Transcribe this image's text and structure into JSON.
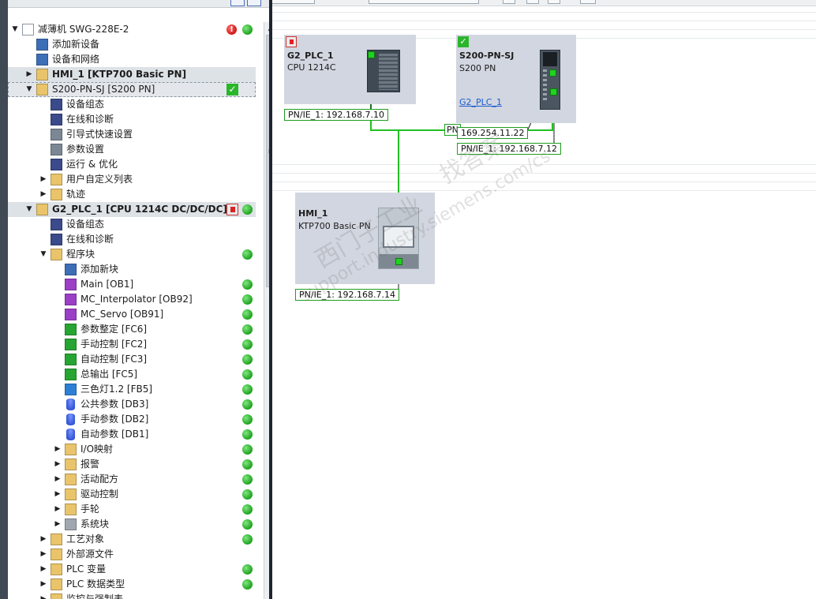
{
  "tree": {
    "rows": [
      {
        "label": "减薄机  SWG-228E-2",
        "indent": 0,
        "expander": "▼",
        "icon": "project-icon",
        "status": "error-ok"
      },
      {
        "label": "添加新设备",
        "indent": 1,
        "expander": "",
        "icon": "add-device-icon"
      },
      {
        "label": "设备和网络",
        "indent": 1,
        "expander": "",
        "icon": "devices-networks-icon"
      },
      {
        "label": "HMI_1 [KTP700 Basic PN]",
        "indent": 1,
        "expander": "▶",
        "icon": "hmi-folder-icon",
        "style": "header"
      },
      {
        "label": "S200-PN-SJ [S200 PN]",
        "indent": 1,
        "expander": "▼",
        "icon": "drive-icon",
        "style": "selected",
        "status": "check"
      },
      {
        "label": "设备组态",
        "indent": 2,
        "expander": "",
        "icon": "device-config-icon"
      },
      {
        "label": "在线和诊断",
        "indent": 2,
        "expander": "",
        "icon": "online-diagnostics-icon"
      },
      {
        "label": "引导式快速设置",
        "indent": 2,
        "expander": "",
        "icon": "quick-setup-icon"
      },
      {
        "label": "参数设置",
        "indent": 2,
        "expander": "",
        "icon": "parameter-icon"
      },
      {
        "label": "运行 & 优化",
        "indent": 2,
        "expander": "",
        "icon": "commissioning-icon"
      },
      {
        "label": "用户自定义列表",
        "indent": 2,
        "expander": "▶",
        "icon": "custom-list-icon"
      },
      {
        "label": "轨迹",
        "indent": 2,
        "expander": "▶",
        "icon": "trace-icon"
      },
      {
        "label": "G2_PLC_1 [CPU 1214C DC/DC/DC]",
        "indent": 1,
        "expander": "▼",
        "icon": "plc-icon",
        "style": "header",
        "status": "download-ok"
      },
      {
        "label": "设备组态",
        "indent": 2,
        "expander": "",
        "icon": "device-config-icon"
      },
      {
        "label": "在线和诊断",
        "indent": 2,
        "expander": "",
        "icon": "online-diagnostics-icon"
      },
      {
        "label": "程序块",
        "indent": 2,
        "expander": "▼",
        "icon": "program-blocks-icon",
        "status": "ok"
      },
      {
        "label": "添加新块",
        "indent": 3,
        "expander": "",
        "icon": "add-block-icon"
      },
      {
        "label": "Main [OB1]",
        "indent": 3,
        "expander": "",
        "icon": "ob-block-icon",
        "status": "ok"
      },
      {
        "label": "MC_Interpolator [OB92]",
        "indent": 3,
        "expander": "",
        "icon": "ob-block-icon",
        "status": "ok"
      },
      {
        "label": "MC_Servo [OB91]",
        "indent": 3,
        "expander": "",
        "icon": "ob-block-icon",
        "status": "ok"
      },
      {
        "label": "参数整定 [FC6]",
        "indent": 3,
        "expander": "",
        "icon": "fc-block-icon",
        "status": "ok"
      },
      {
        "label": "手动控制 [FC2]",
        "indent": 3,
        "expander": "",
        "icon": "fc-block-icon",
        "status": "ok"
      },
      {
        "label": "自动控制 [FC3]",
        "indent": 3,
        "expander": "",
        "icon": "fc-block-icon",
        "status": "ok"
      },
      {
        "label": "总输出 [FC5]",
        "indent": 3,
        "expander": "",
        "icon": "fc-block-icon",
        "status": "ok"
      },
      {
        "label": "三色灯1.2 [FB5]",
        "indent": 3,
        "expander": "",
        "icon": "fb-block-icon",
        "status": "ok"
      },
      {
        "label": "公共参数 [DB3]",
        "indent": 3,
        "expander": "",
        "icon": "db-block-icon",
        "status": "ok"
      },
      {
        "label": "手动参数 [DB2]",
        "indent": 3,
        "expander": "",
        "icon": "db-block-icon",
        "status": "ok"
      },
      {
        "label": "自动参数 [DB1]",
        "indent": 3,
        "expander": "",
        "icon": "db-block-icon",
        "status": "ok"
      },
      {
        "label": "I/O映射",
        "indent": 3,
        "expander": "▶",
        "icon": "group-folder-icon",
        "status": "ok"
      },
      {
        "label": "报警",
        "indent": 3,
        "expander": "▶",
        "icon": "group-folder-icon",
        "status": "ok"
      },
      {
        "label": "活动配方",
        "indent": 3,
        "expander": "▶",
        "icon": "group-folder-icon",
        "status": "ok"
      },
      {
        "label": "驱动控制",
        "indent": 3,
        "expander": "▶",
        "icon": "group-folder-icon",
        "status": "ok"
      },
      {
        "label": "手轮",
        "indent": 3,
        "expander": "▶",
        "icon": "group-folder-icon",
        "status": "ok"
      },
      {
        "label": "系统块",
        "indent": 3,
        "expander": "▶",
        "icon": "system-blocks-icon",
        "status": "ok"
      },
      {
        "label": "工艺对象",
        "indent": 2,
        "expander": "▶",
        "icon": "technology-objects-icon",
        "status": "ok"
      },
      {
        "label": "外部源文件",
        "indent": 2,
        "expander": "▶",
        "icon": "external-source-icon"
      },
      {
        "label": "PLC 变量",
        "indent": 2,
        "expander": "▶",
        "icon": "plc-tags-icon",
        "status": "ok"
      },
      {
        "label": "PLC 数据类型",
        "indent": 2,
        "expander": "▶",
        "icon": "plc-datatypes-icon",
        "status": "ok"
      },
      {
        "label": "监控与强制表",
        "indent": 2,
        "expander": "▶",
        "icon": "watch-force-icon"
      }
    ]
  },
  "network": {
    "devices": {
      "plc": {
        "name": "G2_PLC_1",
        "type": "CPU 1214C",
        "badge": "download-icon"
      },
      "drive": {
        "name": "S200-PN-SJ",
        "type": "S200 PN",
        "link": "G2_PLC_1",
        "badge": "check-icon"
      },
      "hmi": {
        "name": "HMI_1",
        "type": "KTP700 Basic PN"
      }
    },
    "labels": {
      "plc_ip": "PN/IE_1:  192.168.7.10",
      "drive_ip": "PN/IE_1:  192.168.7.12",
      "hmi_ip": "PN/IE_1:  192.168.7.14",
      "drive_online_ip": "169.254.11.22",
      "subnet_partial": "PN"
    },
    "watermark": {
      "line1": "西门子工业",
      "line2": "找答案",
      "line3": "support.industry.siemens.com/cs"
    },
    "colors": {
      "ethernet": "#22c022",
      "device_bg": "#d2d6e0",
      "link": "#1a5bd0"
    }
  }
}
